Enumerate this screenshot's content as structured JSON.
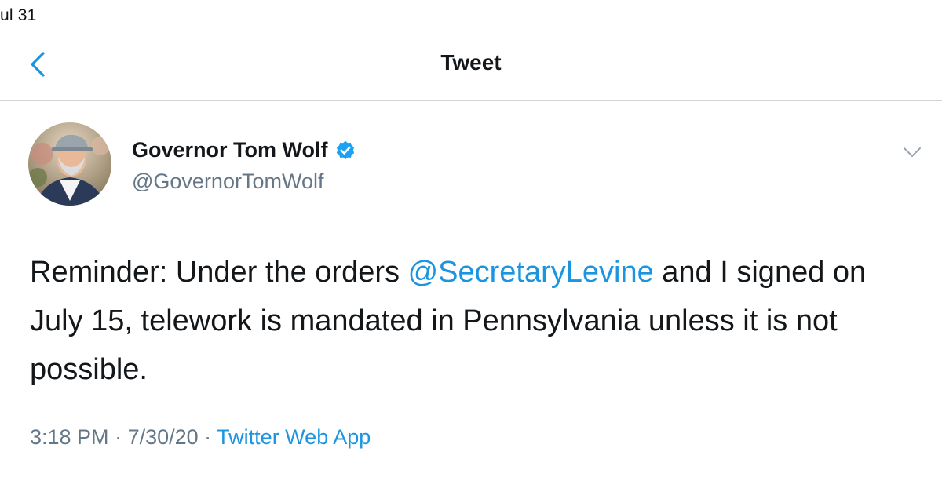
{
  "status_bar": {
    "text": "ul 31"
  },
  "nav": {
    "title": "Tweet",
    "back_icon": "chevron-left-icon"
  },
  "tweet": {
    "author": {
      "name": "Governor Tom Wolf",
      "handle": "@GovernorTomWolf",
      "verified": true
    },
    "text_before": "Reminder: Under the orders ",
    "mention": "@SecretaryLevine",
    "text_after": " and I signed on July 15, telework is mandated in Pennsylvania unless it is not possible.",
    "time": "3:18 PM",
    "separator_1": " · ",
    "date": "7/30/20",
    "separator_2": " · ",
    "source": "Twitter Web App"
  },
  "colors": {
    "link_blue": "#1b95e0",
    "verified_blue": "#1da1f2",
    "secondary_text": "#657786",
    "primary_text": "#14171a",
    "divider": "#d4d4d8"
  }
}
